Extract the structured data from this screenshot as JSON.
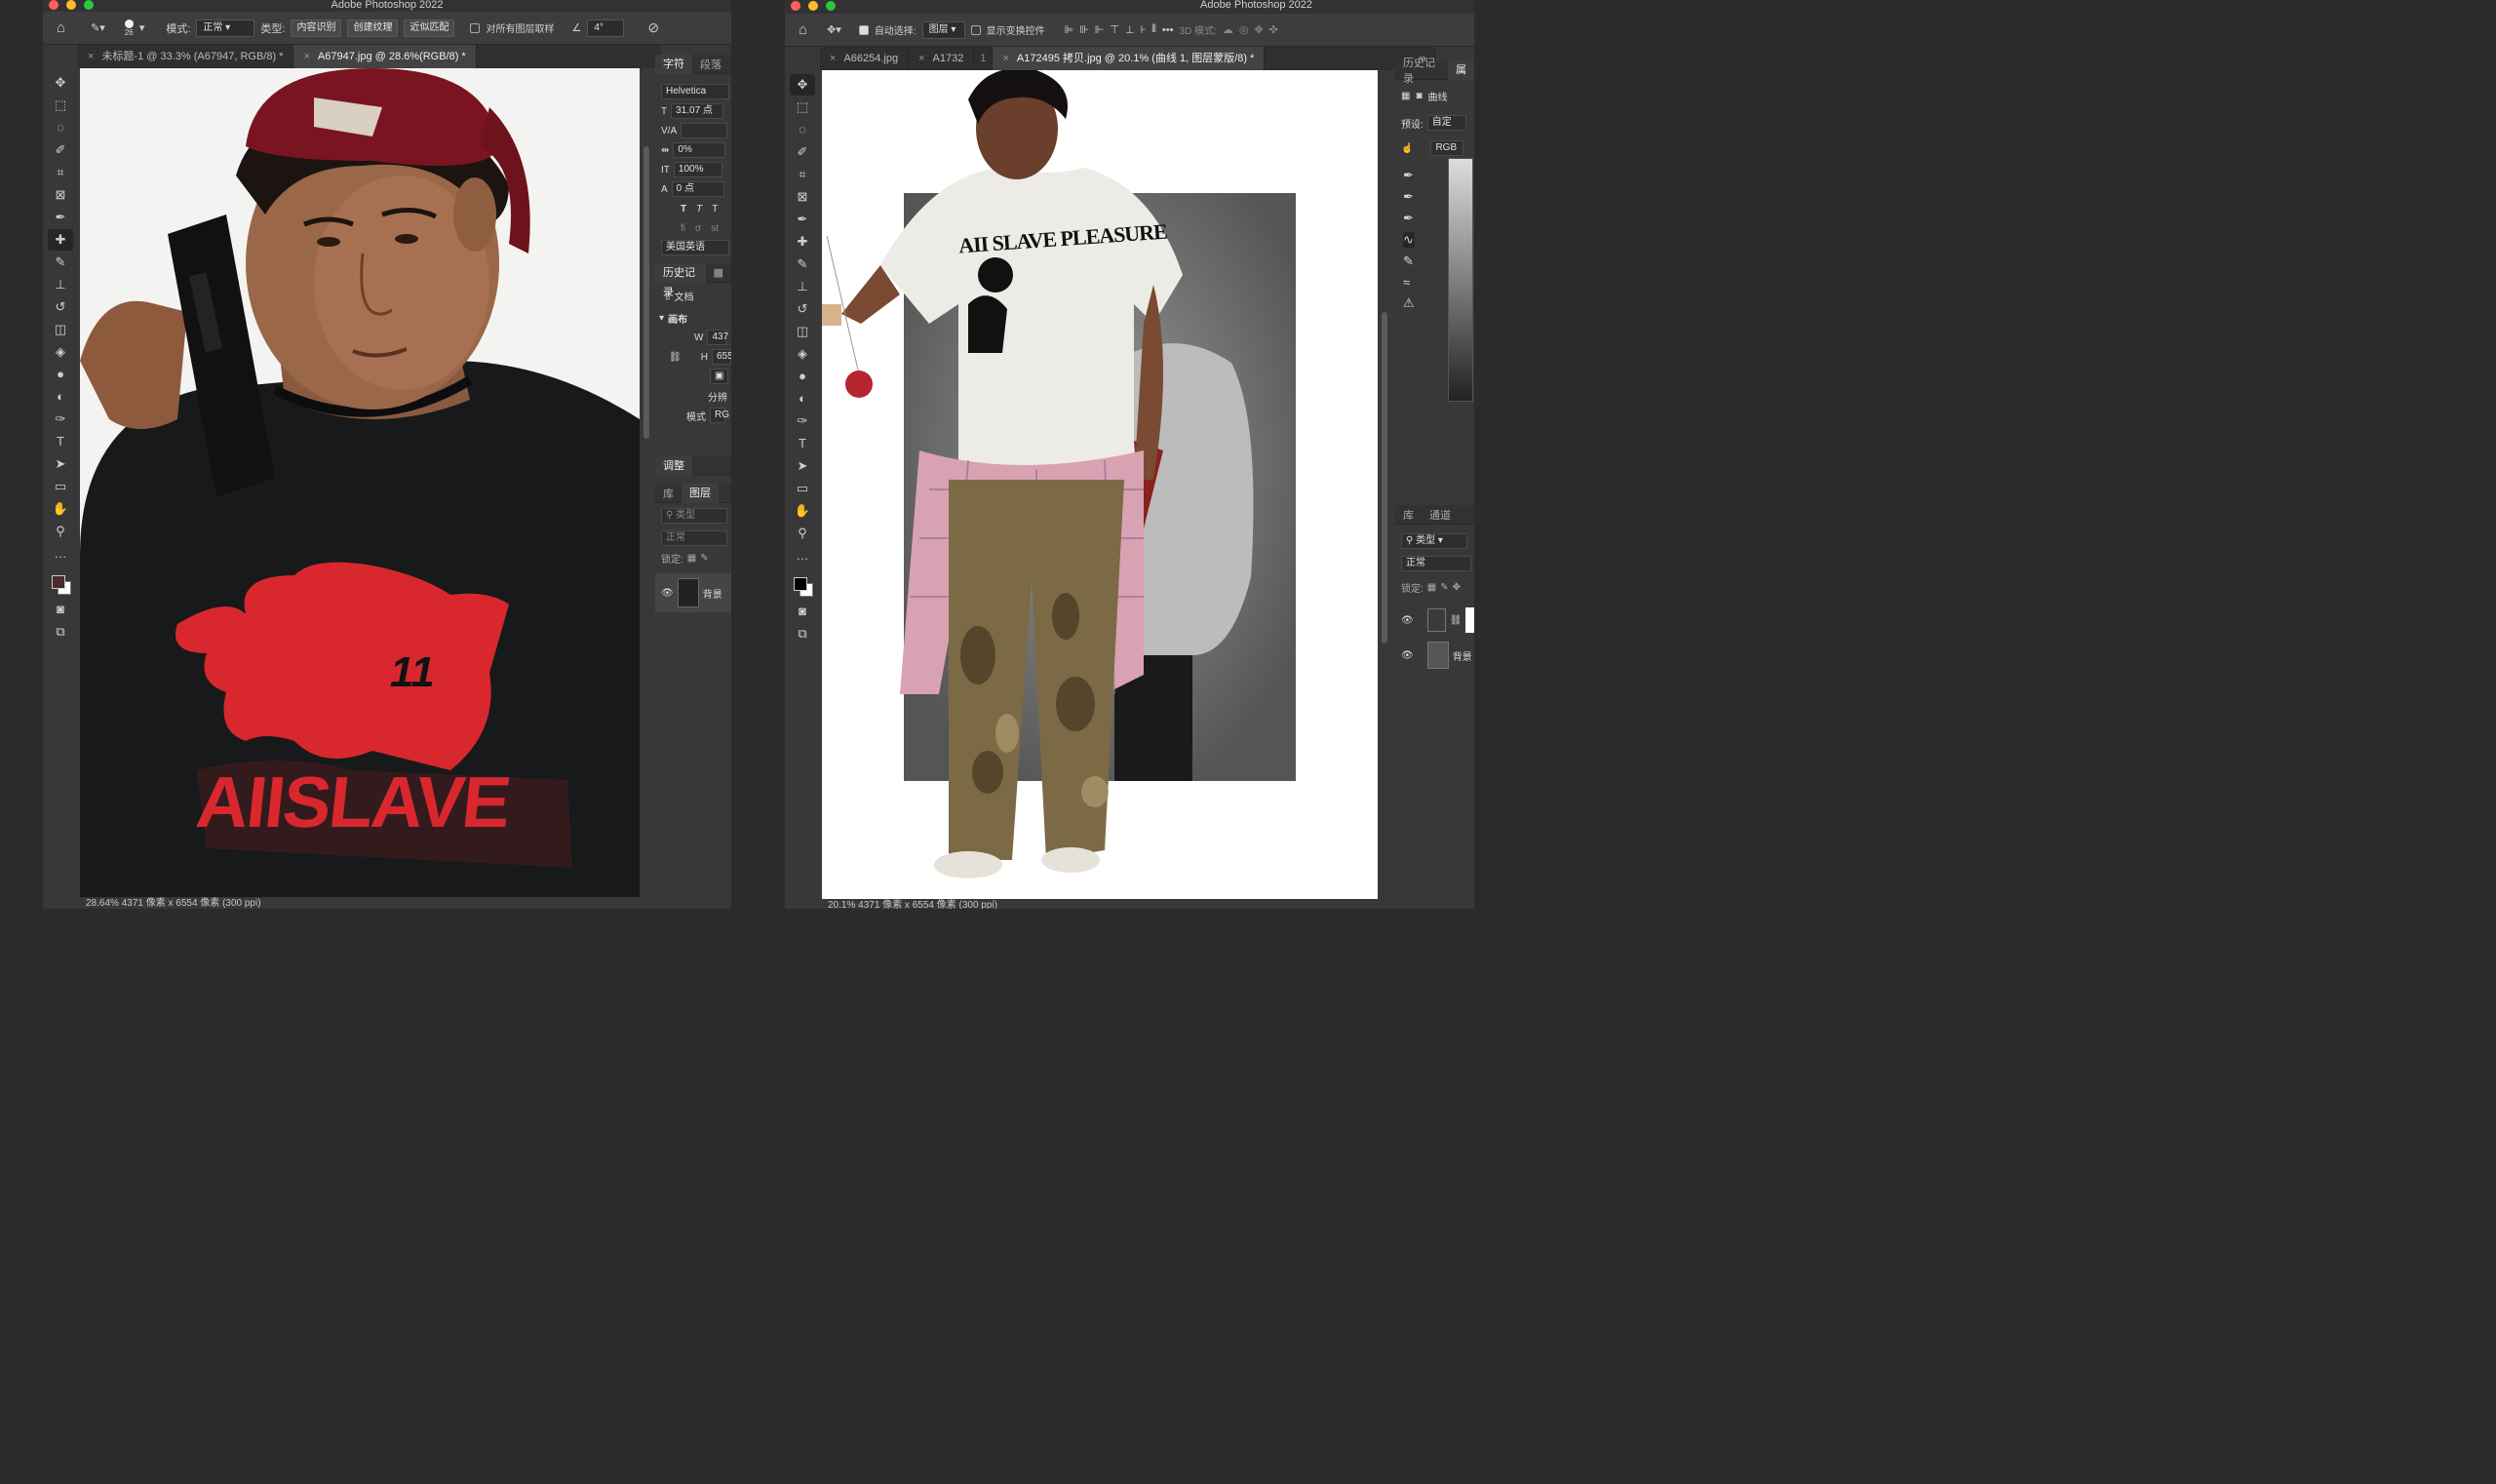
{
  "left_window": {
    "title": "Adobe Photoshop 2022",
    "options": {
      "brush_size": "26",
      "mode_label": "模式:",
      "mode_value": "正常",
      "type_label": "类型:",
      "btn_content_aware": "内容识别",
      "btn_create_texture": "创建纹理",
      "btn_proximity": "近似匹配",
      "sample_all": "对所有图层取样",
      "angle": "4°"
    },
    "tabs": [
      {
        "label": "未标题-1 @ 33.3% (A67947, RGB/8) *"
      },
      {
        "label": "A67947.jpg @ 28.6%(RGB/8) *"
      }
    ],
    "status": "28.64%   4371 像素 x 6554 像素 (300 ppi)",
    "character_panel": {
      "tab_char": "字符",
      "tab_para": "段落",
      "font": "Helvetica",
      "size": "31.07 点",
      "tracking": "0%",
      "vscale": "100%",
      "baseline": "0 点",
      "lang": "美国英语"
    },
    "history_panel": {
      "tab": "历史记录",
      "item": "文档",
      "canvas_label": "画布",
      "w_label": "W",
      "w_value": "437",
      "h_label": "H",
      "h_value": "655",
      "resolution": "分辨",
      "mode_label": "模式",
      "mode_value": "RG"
    },
    "adjust_tab": "调整",
    "layers_panel": {
      "tab_lib": "库",
      "tab_layers": "图层",
      "filter": "类型",
      "blend": "正常",
      "lock": "锁定:",
      "layer_name": "背景"
    },
    "shirt_graphic": {
      "text_top": "11",
      "text_bottom": "AIISLAVE"
    }
  },
  "right_window": {
    "title": "Adobe Photoshop 2022",
    "options": {
      "auto_select": "自动选择:",
      "auto_select_value": "图层",
      "show_transform": "显示变换控件",
      "mode_3d": "3D 模式:"
    },
    "tabs": [
      {
        "label": "A66254.jpg"
      },
      {
        "label": "A1732"
      },
      {
        "label": "1"
      },
      {
        "label": "A172495 拷贝.jpg @ 20.1% (曲线 1, 图层蒙版/8) *"
      }
    ],
    "status": "20.1%   4371 像素 x 6554 像素 (300 ppi)",
    "properties": {
      "tab_history": "历史记录",
      "tab_props": "属",
      "curves": "曲线",
      "preset_label": "预设:",
      "preset_value": "自定",
      "channel": "RGB"
    },
    "layers_panel": {
      "tab_lib": "库",
      "tab_channels": "通道",
      "filter": "类型",
      "blend": "正常",
      "lock": "锁定:",
      "layer_name": "背景"
    },
    "shirt_graphic": {
      "text": "AII SLAVE PLEASURE"
    }
  },
  "colors": {
    "ui_bg": "#383838",
    "dark": "#2b2b2b",
    "cap_red": "#7a1420",
    "flame_red": "#d8282e"
  }
}
